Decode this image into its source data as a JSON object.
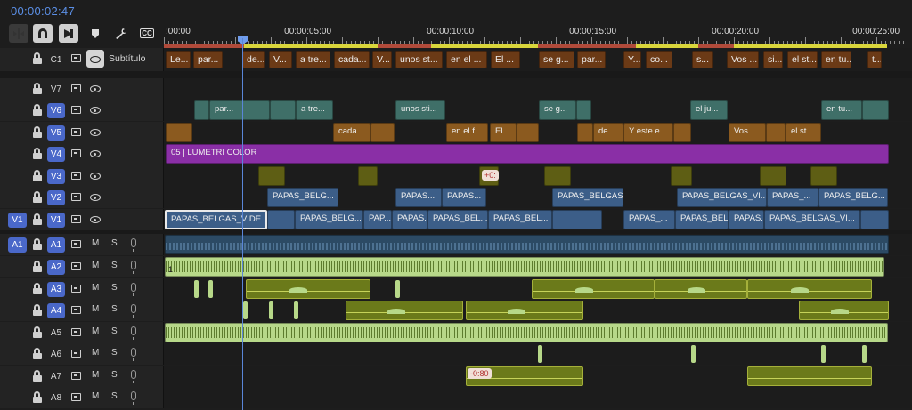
{
  "timecode": "00:00:02:47",
  "toolbar": {
    "snap_icon": "insert-icon",
    "magnet_icon": "snap-magnet-icon",
    "linked_icon": "linked-selection-icon",
    "marker_icon": "marker-icon",
    "wrench_icon": "settings-wrench-icon",
    "cc_label": "CC"
  },
  "ruler": {
    "labels": [
      ":00:00",
      "00:00:05:00",
      "00:00:10:00",
      "00:00:15:00",
      "00:00:20:00",
      "00:00:25:00"
    ]
  },
  "tracks": {
    "c1": {
      "name": "C1",
      "label": "Subtítulo"
    },
    "video": [
      {
        "name": "V7",
        "active": false
      },
      {
        "name": "V6",
        "active": true
      },
      {
        "name": "V5",
        "active": true
      },
      {
        "name": "V4",
        "active": true
      },
      {
        "name": "V3",
        "active": true
      },
      {
        "name": "V2",
        "active": true
      },
      {
        "name": "V1",
        "active": true,
        "source": "V1"
      }
    ],
    "audio": [
      {
        "name": "A1",
        "active": true,
        "source": "A1"
      },
      {
        "name": "A2",
        "active": true
      },
      {
        "name": "A3",
        "active": true
      },
      {
        "name": "A4",
        "active": true
      },
      {
        "name": "A5",
        "active": false
      },
      {
        "name": "A6",
        "active": false
      },
      {
        "name": "A7",
        "active": false
      },
      {
        "name": "A8",
        "active": false
      }
    ],
    "mute": "M",
    "solo": "S"
  },
  "captions": [
    "Le...",
    "par...",
    "de...",
    "V...",
    "a tre...",
    "cada...",
    "V...",
    "unos st...",
    "en el ...",
    "El ...",
    "se g...",
    "par...",
    "Y...",
    "co...",
    "s...",
    "Vos ...",
    "si...",
    "el st...",
    "en tu...",
    "t..."
  ],
  "v6_clips": [
    "par...",
    "a tre...",
    "unos sti...",
    "se g...",
    "el ju...",
    "en tu..."
  ],
  "v5_clips": [
    "cada...",
    "en el f...",
    "El ...",
    "de ...",
    "Y este e...",
    "Vos...",
    "el st..."
  ],
  "v4_clip": "05 | LUMETRI COLOR",
  "v3_badge": "+0:",
  "v2_clips": [
    "PAPAS_BELG...",
    "PAPAS...",
    "PAPAS...",
    "PAPAS_BELGAS...",
    "PAPAS_BELGAS_VI...",
    "PAPAS_...",
    "PAPAS_BELG..."
  ],
  "v1_clips": [
    "PAPAS_BELGAS_VIDE...",
    "PAPAS_BELG...",
    "PAP...",
    "PAPAS...",
    "PAPAS_BEL...",
    "PAPAS_BEL...",
    "PAPAS_...",
    "PAPAS_BEL...",
    "PAPAS...",
    "PAPAS_BELGAS_VI..."
  ],
  "a2_marker": "1",
  "a7_badge": "-0:80"
}
